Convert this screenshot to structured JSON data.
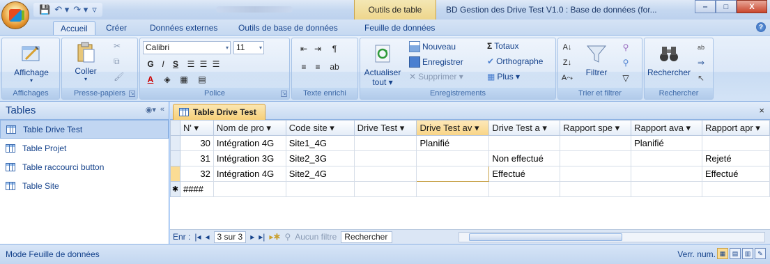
{
  "window": {
    "title": "BD Gestion des Drive Test  V1.0 : Base de données (for...",
    "context_tab": "Outils de table",
    "controls": {
      "minimize": "‒",
      "maximize": "□",
      "close": "X"
    }
  },
  "qat": {
    "save": "💾",
    "undo": "↶ ▾",
    "redo": "↷ ▾",
    "customize": "▿"
  },
  "ribbon_tabs": [
    "Accueil",
    "Créer",
    "Données externes",
    "Outils de base de données",
    "Feuille de données"
  ],
  "active_tab": "Accueil",
  "help": "?",
  "groups": {
    "affichages": {
      "label": "Affichages",
      "affichage": "Affichage"
    },
    "presse_papiers": {
      "label": "Presse-papiers",
      "coller": "Coller"
    },
    "police": {
      "label": "Police",
      "font": "Calibri",
      "size": "11",
      "bold": "G",
      "italic": "I",
      "underline": "S"
    },
    "texte_enrichi": {
      "label": "Texte enrichi"
    },
    "enregistrements": {
      "label": "Enregistrements",
      "actualiser": "Actualiser",
      "actualiser2": "tout ▾",
      "nouveau": "Nouveau",
      "enregistrer": "Enregistrer",
      "supprimer": "Supprimer ▾",
      "totaux": "Totaux",
      "orthographe": "Orthographe",
      "plus": "Plus ▾"
    },
    "trier": {
      "label": "Trier et filtrer",
      "filtrer": "Filtrer"
    },
    "rechercher": {
      "label": "Rechercher",
      "rechercher": "Rechercher"
    }
  },
  "nav": {
    "title": "Tables",
    "items": [
      "Table Drive Test",
      "Table Projet",
      "Table raccourci button",
      "Table Site"
    ],
    "selected": "Table Drive Test"
  },
  "document": {
    "tab": "Table Drive Test",
    "columns": [
      "N' ▾",
      "Nom de pro ▾",
      "Code site ▾",
      "Drive Test ▾",
      "Drive Test av ▾",
      "Drive Test a ▾",
      "Rapport spe ▾",
      "Rapport ava ▾",
      "Rapport apr ▾"
    ],
    "rows": [
      [
        "30",
        "Intégration 4G",
        "Site1_4G",
        "",
        "Planifié",
        "",
        "",
        "Planifié",
        ""
      ],
      [
        "31",
        "Intégration 3G",
        "Site2_3G",
        "",
        "",
        "Non effectué",
        "",
        "",
        "Rejeté"
      ],
      [
        "32",
        "Intégration 4G",
        "Site2_4G",
        "",
        "",
        "Effectué",
        "",
        "",
        "Effectué"
      ]
    ],
    "new_row": "####",
    "new_row_marker": "✱",
    "record_nav": {
      "label": "Enr :",
      "position": "3 sur 3",
      "filter": "Aucun filtre",
      "search": "Rechercher"
    }
  },
  "status": {
    "mode": "Mode Feuille de données",
    "num": "Verr. num."
  }
}
